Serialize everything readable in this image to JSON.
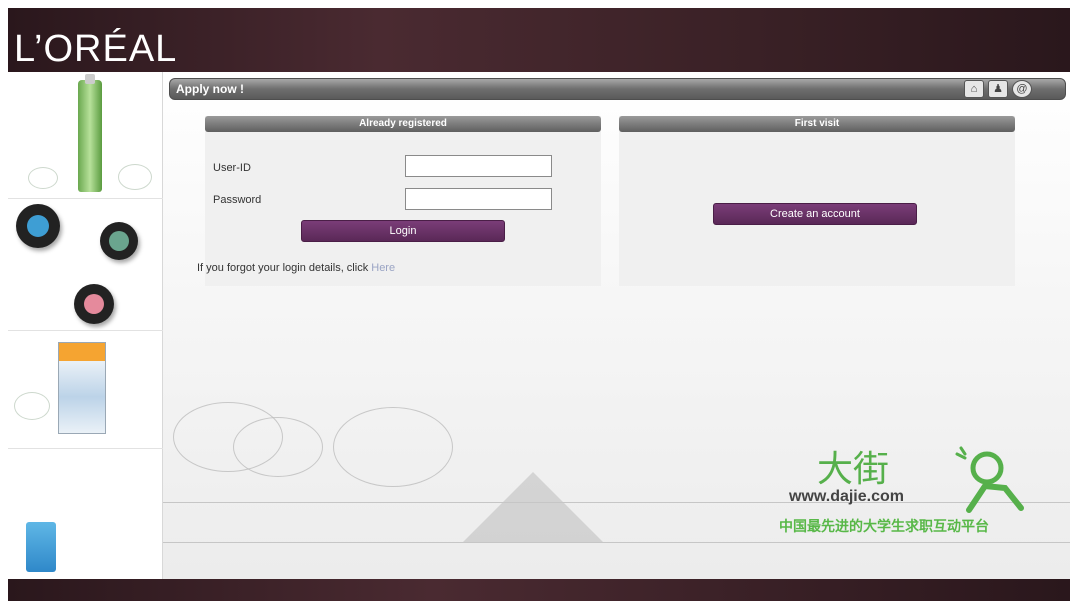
{
  "brand": {
    "logo_text": "L’ORÉAL"
  },
  "header": {
    "title": "Apply now !",
    "icons": [
      "home-icon",
      "user-icon",
      "at-icon"
    ]
  },
  "already_registered": {
    "heading": "Already registered",
    "user_label": "User-ID",
    "password_label": "Password",
    "user_value": "",
    "password_value": "",
    "login_button": "Login",
    "forgot_text": "If you forgot your login details, click ",
    "forgot_link": "Here"
  },
  "first_visit": {
    "heading": "First visit",
    "create_button": "Create an account"
  },
  "watermark": {
    "cn_title": "大街",
    "url": "www.dajie.com",
    "slogan": "中国最先进的大学生求职互动平台"
  },
  "colors": {
    "brand_bar": "#3a2126",
    "button_purple": "#6a3167",
    "watermark_green": "#56b04b"
  }
}
